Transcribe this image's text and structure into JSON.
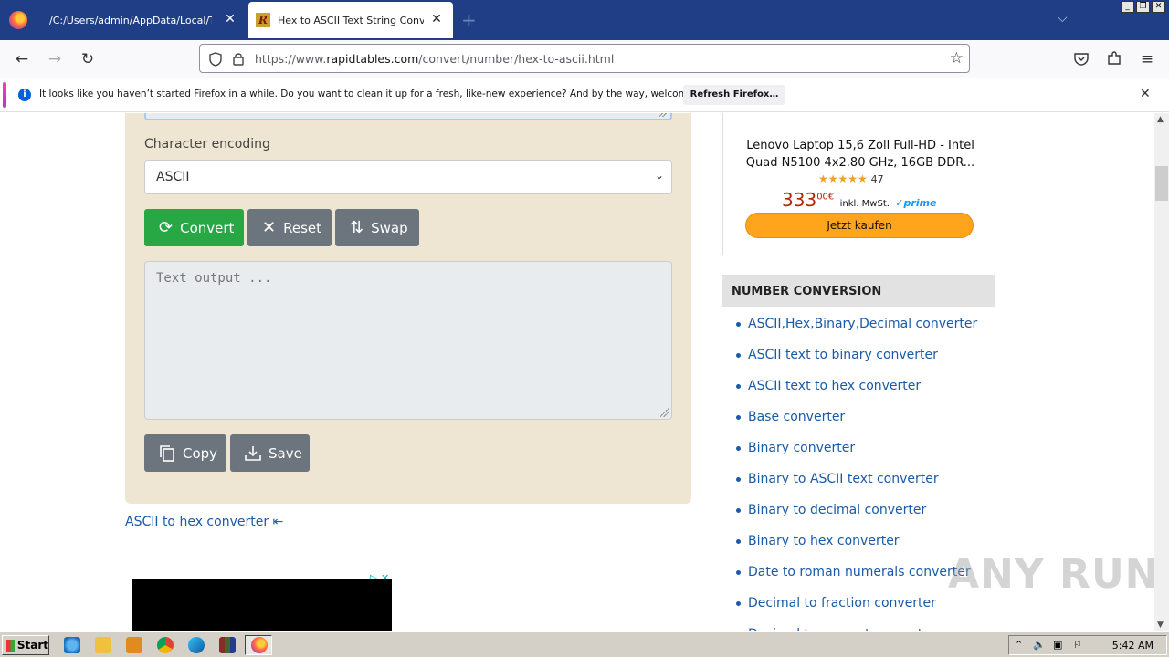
{
  "browser": {
    "tabs": [
      {
        "title": "/C:/Users/admin/AppData/Local/Temp/H",
        "active": false
      },
      {
        "title": "Hex to ASCII Text String Converter",
        "active": true,
        "favicon_letter": "R"
      }
    ],
    "new_tab_glyph": "+",
    "url_prefix": "https://www.",
    "url_domain": "rapidtables.com",
    "url_path": "/convert/number/hex-to-ascii.html"
  },
  "notification": {
    "message": "It looks like you haven’t started Firefox in a while. Do you want to clean it up for a fresh, like-new experience? And by the way, welcome back!",
    "button": "Refresh Firefox…"
  },
  "converter": {
    "encoding_label": "Character encoding",
    "encoding_value": "ASCII",
    "buttons": {
      "convert": "Convert",
      "reset": "Reset",
      "swap": "Swap",
      "copy": "Copy",
      "save": "Save"
    },
    "output_placeholder": "Text output ..."
  },
  "backlink": "ASCII to hex converter",
  "ad": {
    "title": "Lenovo Laptop 15,6 Zoll Full-HD - Intel Quad N5100 4x2.80 GHz, 16GB DDR...",
    "rating_count": "47",
    "price_main": "333",
    "price_cents": "00€",
    "price_note": "inkl. MwSt.",
    "prime": "prime",
    "buy_label": "Jetzt kaufen"
  },
  "sidebar": {
    "heading": "NUMBER CONVERSION",
    "links": [
      "ASCII,Hex,Binary,Decimal converter",
      "ASCII text to binary converter",
      "ASCII text to hex converter",
      "Base converter",
      "Binary converter",
      "Binary to ASCII text converter",
      "Binary to decimal converter",
      "Binary to hex converter",
      "Date to roman numerals converter",
      "Decimal to fraction converter",
      "Decimal to percent converter"
    ]
  },
  "watermark": "ANY RUN",
  "taskbar": {
    "start_label": "Start",
    "time": "5:42 AM"
  },
  "colors": {
    "tabbar": "#1f3e86",
    "convert_button": "#28a745",
    "gray_button": "#6c757d",
    "panel": "#eee6d3",
    "link": "#1a5aa6"
  }
}
